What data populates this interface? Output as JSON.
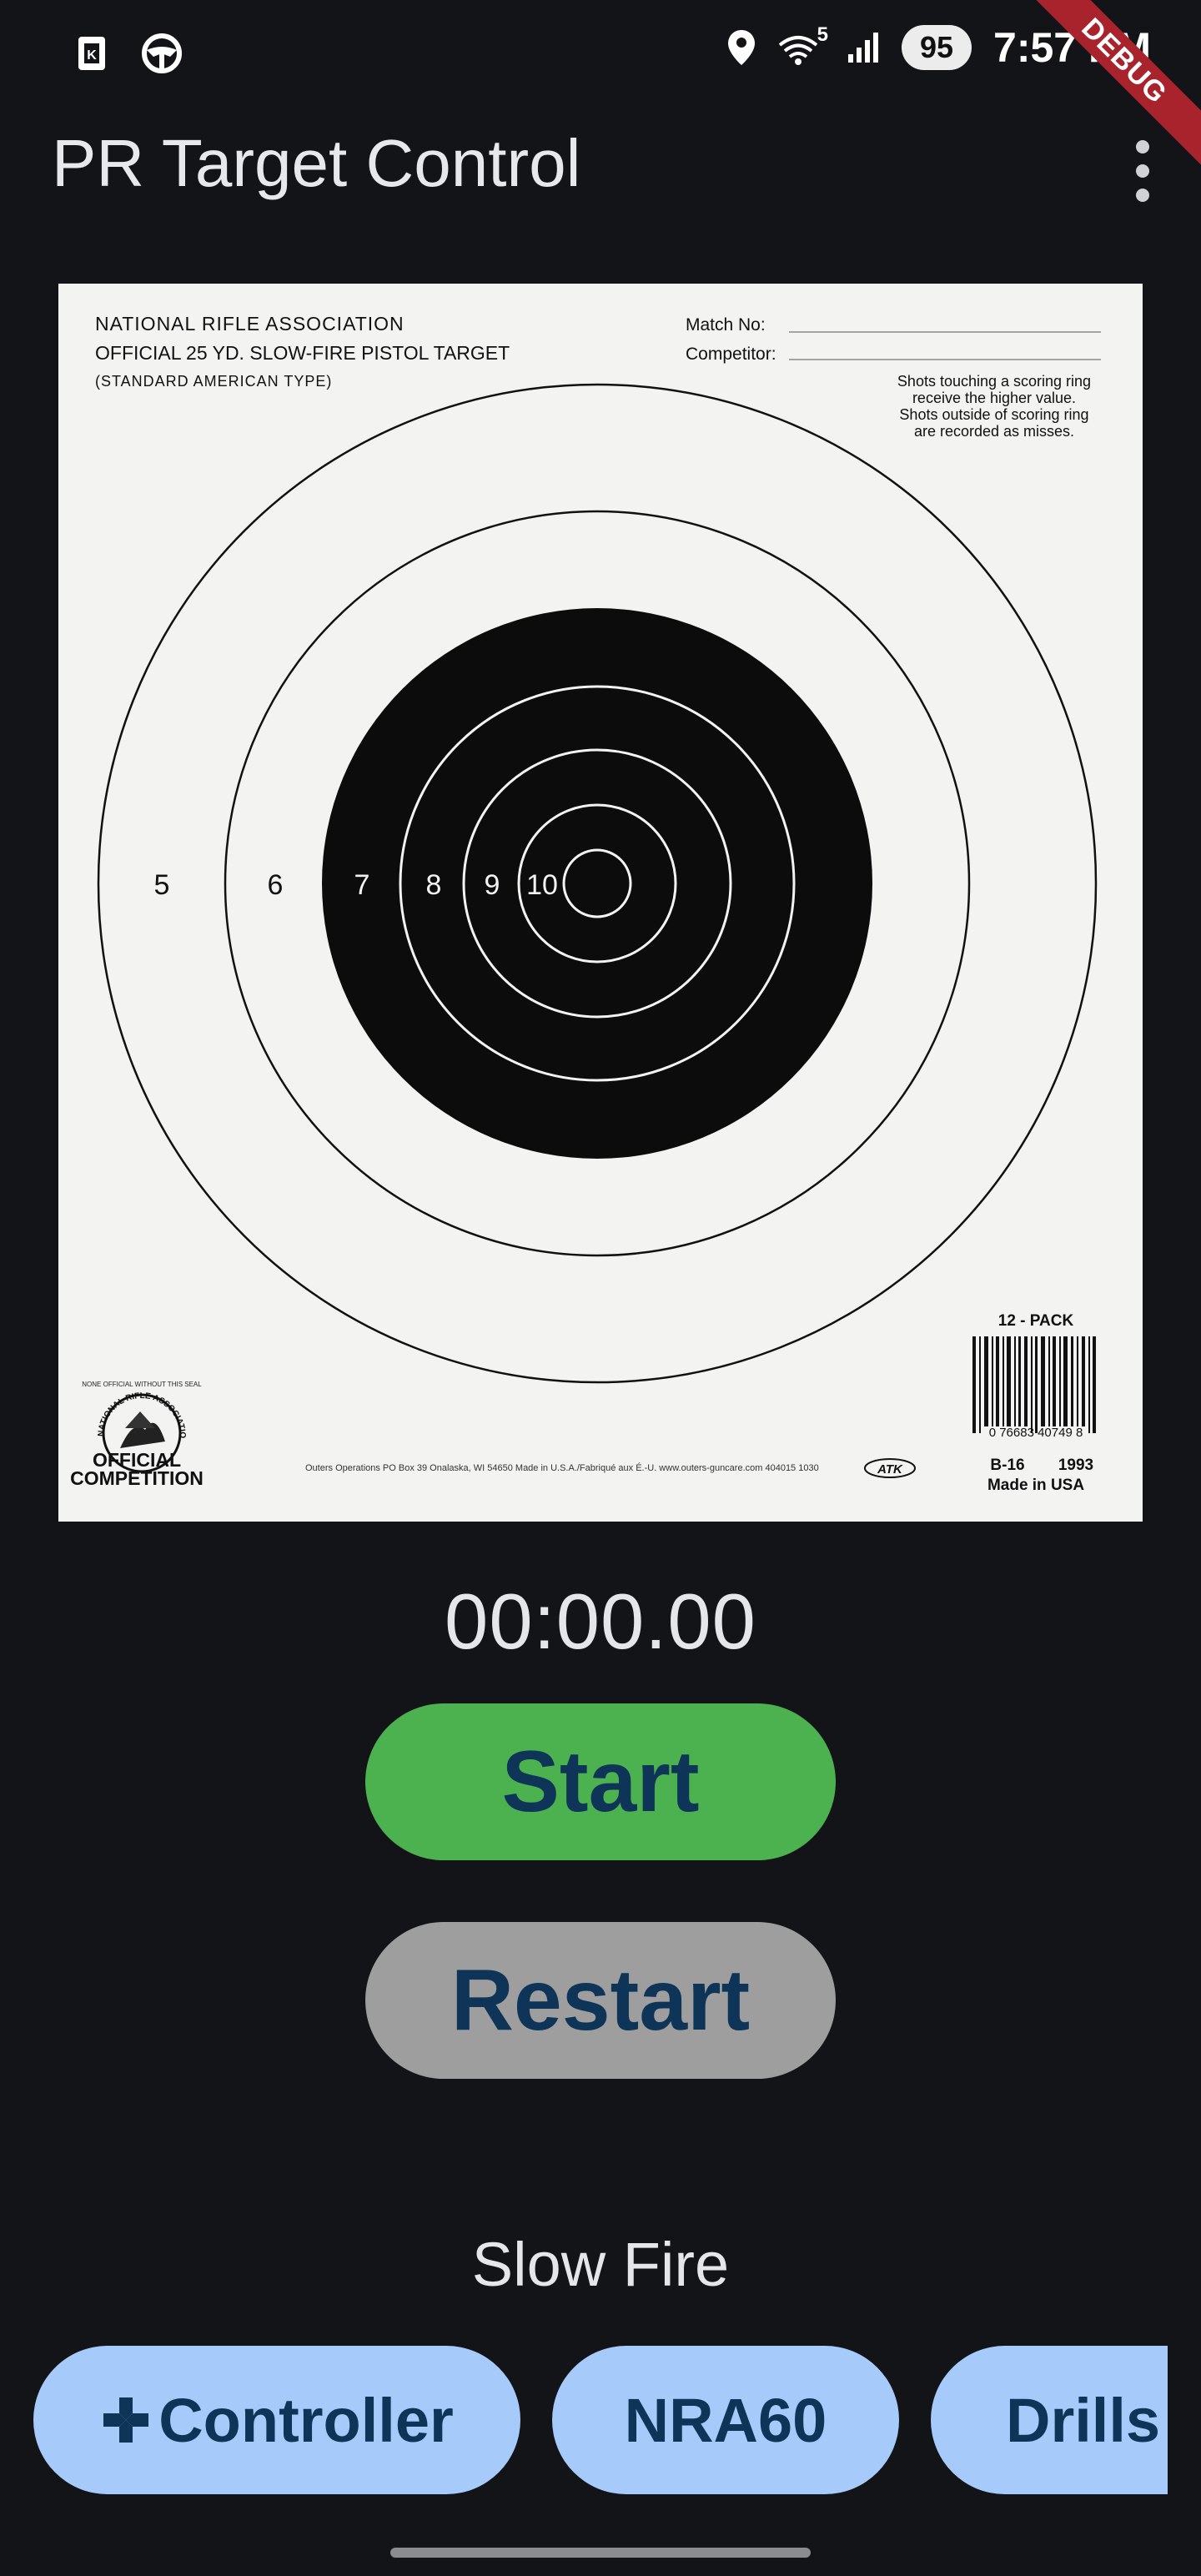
{
  "status_bar": {
    "left_icons": [
      "k-badge-icon",
      "steering-wheel-icon"
    ],
    "right_icons": [
      "location-pin-icon",
      "wifi-icon",
      "signal-icon"
    ],
    "wifi_label": "5",
    "battery": "95",
    "time": "7:57 PM",
    "debug_banner": "DEBUG"
  },
  "app_bar": {
    "title": "PR Target Control",
    "menu_icon": "more-vert-icon"
  },
  "target": {
    "header_line1": "NATIONAL RIFLE ASSOCIATION",
    "header_line2": "OFFICIAL 25 YD. SLOW-FIRE PISTOL TARGET",
    "header_line3": "(STANDARD AMERICAN TYPE)",
    "match_label": "Match No:",
    "competitor_label": "Competitor:",
    "rules_note": [
      "Shots touching a scoring ring",
      "receive the higher value.",
      "Shots outside of scoring ring",
      "are recorded as misses."
    ],
    "ring_numbers": [
      "5",
      "6",
      "7",
      "8",
      "9",
      "10"
    ],
    "pack_label": "12 - PACK",
    "barcode_number": "0  76683  40749  8",
    "model": "B-16",
    "year": "1993",
    "made_in": "Made in USA",
    "footer_text": "Outers Operations   PO Box 39   Onalaska, WI 54650   Made in U.S.A./Fabriqué aux É.-U.   www.outers-guncare.com   404015   1030",
    "atk_logo": "ATK",
    "seal_top": "NONE OFFICIAL WITHOUT THIS SEAL",
    "seal_ring_text": "NATIONAL RIFLE ASSOCIATION",
    "seal_line1": "OFFICIAL",
    "seal_line2": "COMPETITION"
  },
  "timer": "00:00.00",
  "buttons": {
    "start": "Start",
    "restart": "Restart"
  },
  "mode_label": "Slow Fire",
  "chips": [
    {
      "label": "Controller",
      "icon": "gamepad-icon"
    },
    {
      "label": "NRA60"
    },
    {
      "label": "Drills"
    }
  ],
  "colors": {
    "background": "#121418",
    "start_button": "#4cb250",
    "restart_button": "#9e9e9e",
    "chip": "#a6cbfa",
    "button_text": "#0e3458",
    "debug_ribbon": "#a8232b"
  }
}
